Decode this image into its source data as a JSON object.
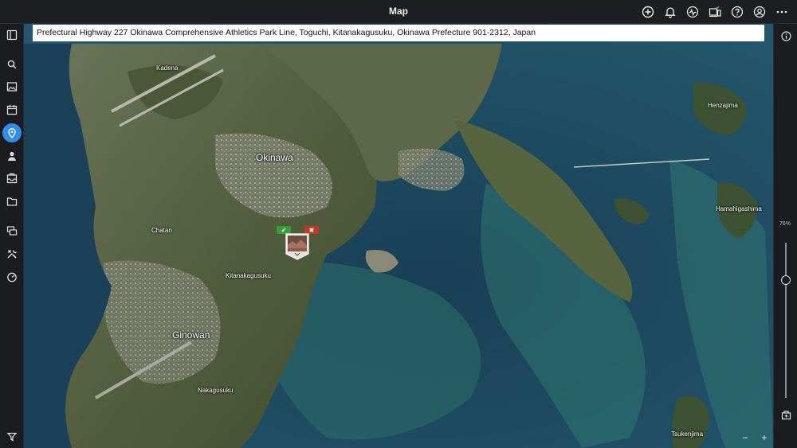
{
  "window": {
    "title": "Map"
  },
  "header": {
    "icons": [
      "add-circle-icon",
      "bell-icon",
      "activity-icon",
      "devices-icon",
      "help-icon",
      "account-icon",
      "more-icon"
    ]
  },
  "sidebar": {
    "items": [
      "panel-toggle-icon",
      "search-icon",
      "image-icon",
      "calendar-icon",
      "map-pin-icon",
      "person-icon",
      "inbox-icon",
      "folder-icon",
      "stack-icon",
      "tools-icon",
      "gauge-icon",
      "filter-icon"
    ],
    "active": "map-pin-icon"
  },
  "address": {
    "text": "Prefectural Highway 227 Okinawa Comprehensive Athletics Park Line, Toguchi, Kitanakagusuku, Okinawa Prefecture 901-2312, Japan"
  },
  "map": {
    "labels": {
      "kadena": "Kadena",
      "okinawa": "Okinawa",
      "chatan": "Chatan",
      "kitanakagusuku": "Kitanakagusuku",
      "ginowan": "Ginowan",
      "nakagusuku": "Nakagusuku",
      "henzajima": "Henzajima",
      "hamahigashima": "Hamahigashima",
      "tsukenjima": "Tsukenjima"
    },
    "marker": {
      "confirm_symbol": "✔",
      "reject_symbol": "✖"
    }
  },
  "zoom": {
    "label": "76%",
    "level": 0.76,
    "minus": "−",
    "plus": "+"
  },
  "colors": {
    "accent": "#2f8fe6",
    "sea_deep": "#1f4a63",
    "land": "#4a5a3a",
    "confirm": "#3a9b3a",
    "reject": "#c0392b"
  }
}
